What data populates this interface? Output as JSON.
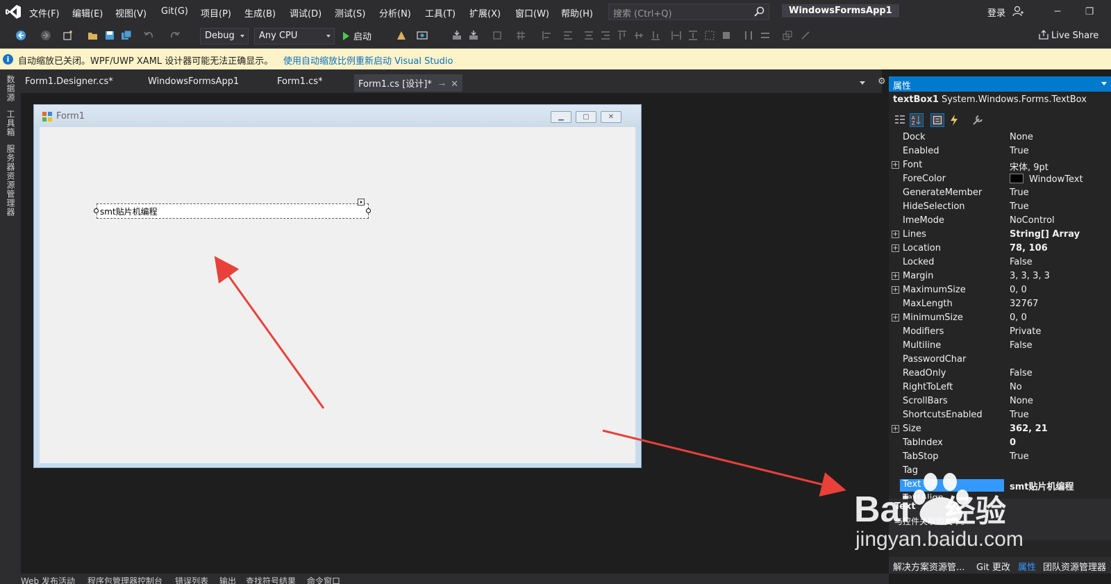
{
  "menu": {
    "items": [
      "文件(F)",
      "编辑(E)",
      "视图(V)",
      "Git(G)",
      "项目(P)",
      "生成(B)",
      "调试(D)",
      "测试(S)",
      "分析(N)",
      "工具(T)",
      "扩展(X)",
      "窗口(W)",
      "帮助(H)"
    ],
    "search_placeholder": "搜索 (Ctrl+Q)",
    "solution_title": "WindowsFormsApp1",
    "login": "登录"
  },
  "toolbar": {
    "config": "Debug",
    "platform": "Any CPU",
    "start": "启动",
    "live_share": "Live Share"
  },
  "infobar": {
    "message": "自动缩放已关闭。WPF/UWP XAML 设计器可能无法正确显示。",
    "link": "使用自动缩放比例重新启动 Visual Studio"
  },
  "left_sidebar": {
    "tabs": [
      "数据源",
      "工具箱",
      "服务器资源管理器"
    ]
  },
  "doc_tabs": {
    "items": [
      "Form1.Designer.cs*",
      "WindowsFormsApp1",
      "Form1.cs*",
      "Form1.cs [设计]*"
    ]
  },
  "form": {
    "title": "Form1",
    "textbox_text": "smt贴片机编程"
  },
  "properties": {
    "header": "属性",
    "object_name": "textBox1",
    "object_type": "System.Windows.Forms.TextBox",
    "rows": [
      {
        "name": "Dock",
        "value": "None",
        "expandable": false,
        "bold": false
      },
      {
        "name": "Enabled",
        "value": "True",
        "expandable": false,
        "bold": false
      },
      {
        "name": "Font",
        "value": "宋体, 9pt",
        "expandable": true,
        "bold": false
      },
      {
        "name": "ForeColor",
        "value": "WindowText",
        "expandable": false,
        "bold": false,
        "swatch": "#000000"
      },
      {
        "name": "GenerateMember",
        "value": "True",
        "expandable": false,
        "bold": false
      },
      {
        "name": "HideSelection",
        "value": "True",
        "expandable": false,
        "bold": false
      },
      {
        "name": "ImeMode",
        "value": "NoControl",
        "expandable": false,
        "bold": false
      },
      {
        "name": "Lines",
        "value": "String[] Array",
        "expandable": true,
        "bold": true
      },
      {
        "name": "Location",
        "value": "78, 106",
        "expandable": true,
        "bold": true
      },
      {
        "name": "Locked",
        "value": "False",
        "expandable": false,
        "bold": false
      },
      {
        "name": "Margin",
        "value": "3, 3, 3, 3",
        "expandable": true,
        "bold": false
      },
      {
        "name": "MaximumSize",
        "value": "0, 0",
        "expandable": true,
        "bold": false
      },
      {
        "name": "MaxLength",
        "value": "32767",
        "expandable": false,
        "bold": false
      },
      {
        "name": "MinimumSize",
        "value": "0, 0",
        "expandable": true,
        "bold": false
      },
      {
        "name": "Modifiers",
        "value": "Private",
        "expandable": false,
        "bold": false
      },
      {
        "name": "Multiline",
        "value": "False",
        "expandable": false,
        "bold": false
      },
      {
        "name": "PasswordChar",
        "value": "",
        "expandable": false,
        "bold": false
      },
      {
        "name": "ReadOnly",
        "value": "False",
        "expandable": false,
        "bold": false
      },
      {
        "name": "RightToLeft",
        "value": "No",
        "expandable": false,
        "bold": false
      },
      {
        "name": "ScrollBars",
        "value": "None",
        "expandable": false,
        "bold": false
      },
      {
        "name": "ShortcutsEnabled",
        "value": "True",
        "expandable": false,
        "bold": false
      },
      {
        "name": "Size",
        "value": "362, 21",
        "expandable": true,
        "bold": true
      },
      {
        "name": "TabIndex",
        "value": "0",
        "expandable": false,
        "bold": true
      },
      {
        "name": "TabStop",
        "value": "True",
        "expandable": false,
        "bold": false
      },
      {
        "name": "Tag",
        "value": "",
        "expandable": false,
        "bold": false
      },
      {
        "name": "Text",
        "value": "smt贴片机编程",
        "expandable": false,
        "bold": true,
        "selected": true
      },
      {
        "name": "TextAlign",
        "value": "",
        "expandable": false,
        "bold": false
      }
    ],
    "description_title": "Text",
    "description": "与控件关联的文本。"
  },
  "right_bottom_tabs": [
    "解决方案资源管...",
    "Git 更改",
    "属性",
    "团队资源管理器"
  ],
  "bottom_tabs": [
    "Web 发布活动",
    "程序包管理器控制台",
    "错误列表",
    "输出",
    "查找符号结果",
    "命令窗口"
  ],
  "watermark": {
    "brand": "Bai",
    "brand_cn": "经验",
    "url": "jingyan.baidu.com"
  },
  "colors": {
    "accent": "#007acc",
    "annotation_arrow": "#e8413a",
    "infobar_bg": "#fcf3c8"
  }
}
